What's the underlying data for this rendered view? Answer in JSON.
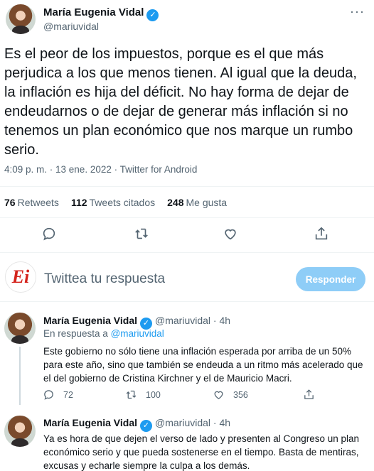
{
  "main_tweet": {
    "author_name": "María Eugenia Vidal",
    "author_handle": "@mariuvidal",
    "more_icon": "more-dots-icon",
    "text": "Es el peor de los impuestos, porque es el que más perjudica a los que menos tienen. Al igual que la deuda, la inflación es hija del déficit. No hay forma de dejar de endeudarnos o de dejar de generar más inflación si no tenemos un plan económico que nos marque un rumbo serio.",
    "meta": "4:09 p. m. · 13 ene. 2022 · Twitter for Android",
    "stats": {
      "retweets_count": "76",
      "retweets_label": "Retweets",
      "quotes_count": "112",
      "quotes_label": "Tweets citados",
      "likes_count": "248",
      "likes_label": "Me gusta"
    }
  },
  "composer": {
    "logo_text": "Ei",
    "placeholder": "Twittea tu respuesta",
    "reply_button": "Responder"
  },
  "replies": [
    {
      "author_name": "María Eugenia Vidal",
      "author_handle": "@mariuvidal · 4h",
      "in_reply_prefix": "En respuesta a ",
      "in_reply_mention": "@mariuvidal",
      "text": "Este gobierno no sólo tiene una inflación esperada por arriba de un 50% para este año, sino que también se endeuda a un ritmo más acelerado que el del gobierno de Cristina Kirchner y el de Mauricio Macri.",
      "replies_count": "72",
      "retweets_count": "100",
      "likes_count": "356"
    },
    {
      "author_name": "María Eugenia Vidal",
      "author_handle": "@mariuvidal · 4h",
      "text": "Ya es hora de que dejen el verso de lado y presenten al Congreso un plan económico serio y que pueda sostenerse en el tiempo. Basta de mentiras, excusas y echarle siempre la culpa a los demás."
    }
  ],
  "colors": {
    "accent": "#1d9bf0",
    "muted_text": "#536471",
    "reply_button_disabled": "#8ecdf7"
  }
}
